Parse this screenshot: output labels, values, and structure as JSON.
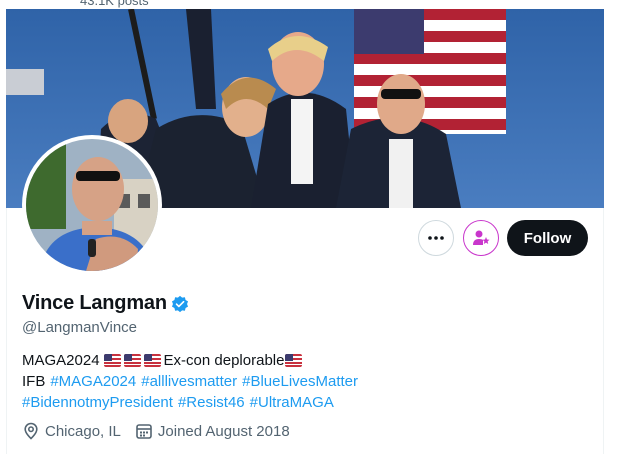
{
  "top_cut_text": "43.1K posts",
  "profile": {
    "name": "Vince Langman",
    "handle": "@LangmanVince",
    "bio_line1_text": "Ex-con deplorable",
    "bio_line1_prefix": "MAGA2024",
    "bio_line2_prefix": "IFB",
    "bio_line2_tags": [
      "#MAGA2024",
      "#alllivesmatter",
      "#BlueLivesMatter"
    ],
    "bio_line3_tags": [
      "#BidennotmyPresident",
      "#Resist46",
      "#UltraMAGA"
    ],
    "location": "Chicago, IL",
    "joined": "Joined August 2018"
  },
  "buttons": {
    "more_icon": "more-icon",
    "subscribe_icon": "subscribe-icon",
    "follow_label": "Follow"
  },
  "colors": {
    "link": "#1d9bf0",
    "follow_bg": "#0f1419",
    "verified": "#1d9bf0",
    "subscribe": "#c936cc"
  }
}
